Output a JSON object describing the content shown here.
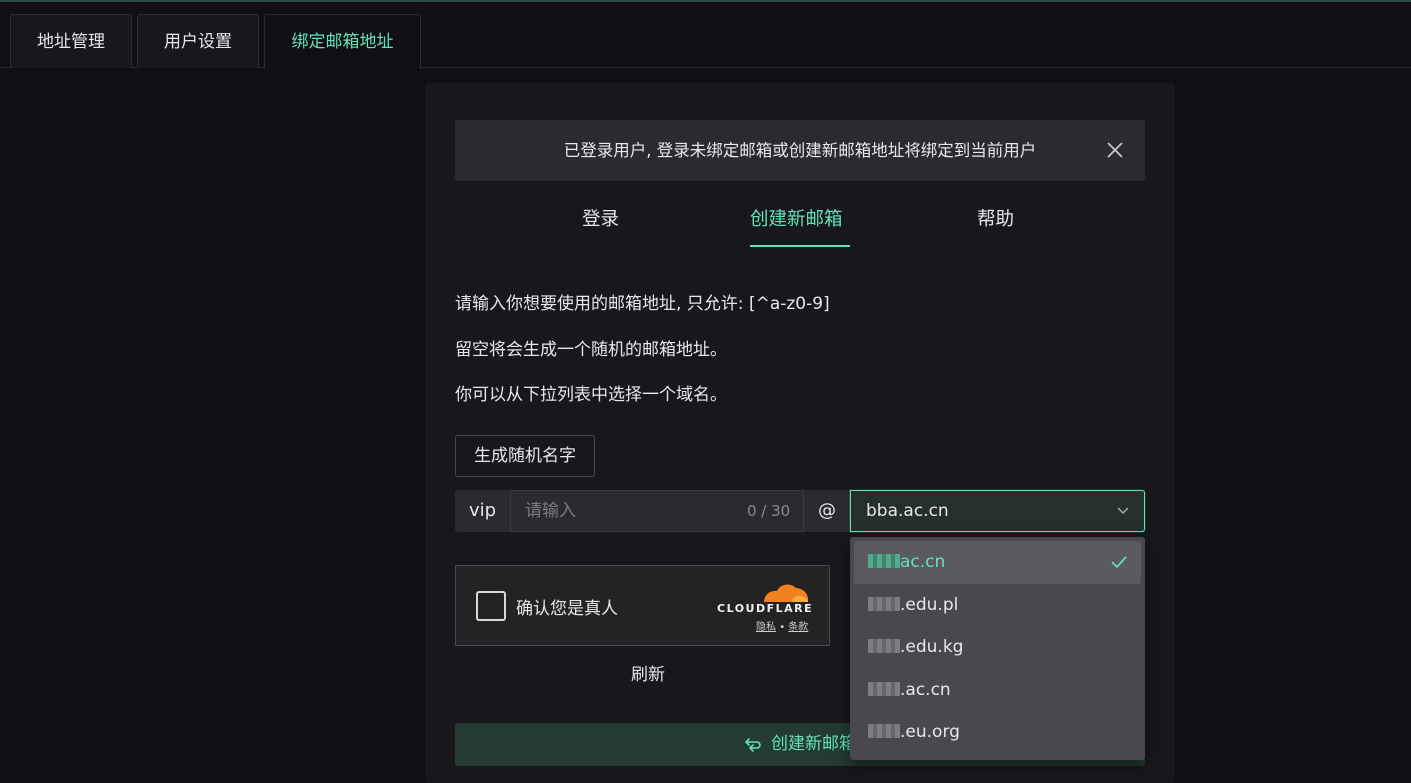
{
  "main_tabs": [
    {
      "label": "地址管理"
    },
    {
      "label": "用户设置"
    },
    {
      "label": "绑定邮箱地址",
      "active": true
    }
  ],
  "alert": {
    "text": "已登录用户, 登录未绑定邮箱或创建新邮箱地址将绑定到当前用户",
    "close_icon": "close-icon"
  },
  "inner_tabs": [
    {
      "label": "登录"
    },
    {
      "label": "创建新邮箱",
      "active": true
    },
    {
      "label": "帮助"
    }
  ],
  "hints": [
    "请输入你想要使用的邮箱地址, 只允许: [^a-z0-9]",
    "留空将会生成一个随机的邮箱地址。",
    "你可以从下拉列表中选择一个域名。"
  ],
  "generate_button": "生成随机名字",
  "address_input": {
    "prefix": "vip",
    "placeholder": "请输入",
    "value": "",
    "counter": "0 / 30",
    "at": "@",
    "selected_domain": "bba.ac.cn"
  },
  "captcha": {
    "label": "确认您是真人",
    "brand": "CLOUDFLARE",
    "privacy": "隐私",
    "separator": "•",
    "terms": "条款"
  },
  "refresh": "刷新",
  "create_button": "创建新邮箱",
  "domain_options": [
    {
      "suffix": "ac.cn",
      "selected": true
    },
    {
      "suffix": ".edu.pl"
    },
    {
      "suffix": ".edu.kg"
    },
    {
      "suffix": ".ac.cn"
    },
    {
      "suffix": ".eu.org"
    }
  ],
  "colors": {
    "accent": "#63e2b7",
    "background": "#101014",
    "card": "#18181c"
  }
}
